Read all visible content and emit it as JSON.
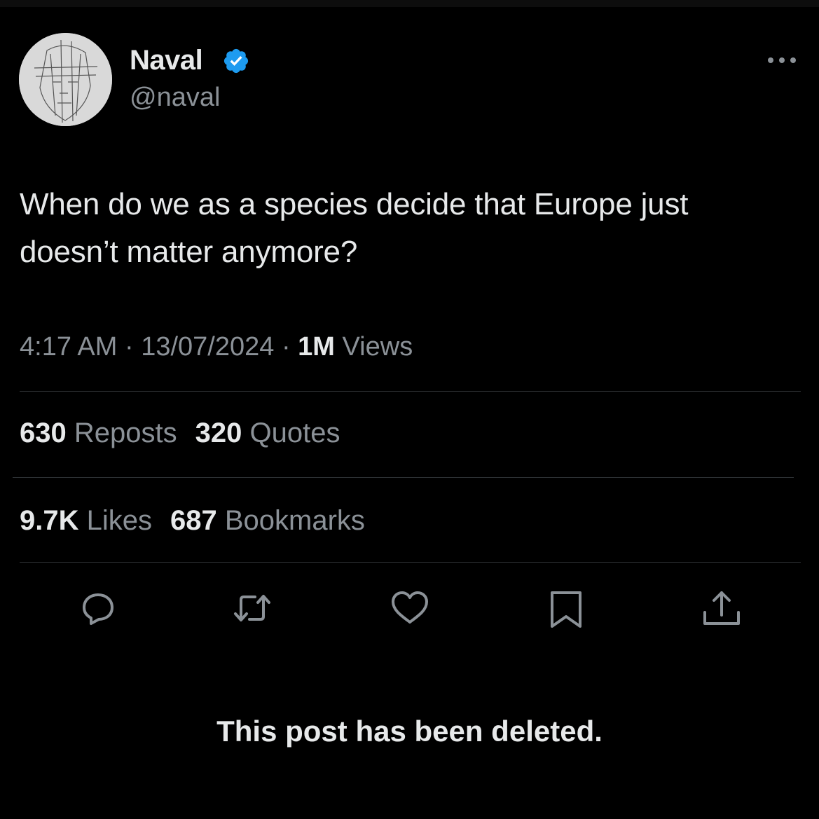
{
  "author": {
    "display_name": "Naval",
    "handle": "@naval",
    "verified": true,
    "verified_color": "#1d9bf0"
  },
  "post": {
    "text_line_1": "When do we as a species decide that Europe just",
    "text_line_2": "doesn’t matter anymore?"
  },
  "meta": {
    "time": "4:17 AM",
    "sep1": " · ",
    "date": "13/07/2024",
    "sep2": " · ",
    "views_count": "1M",
    "views_label": " Views"
  },
  "stats": {
    "reposts_count": "630",
    "reposts_label": " Reposts",
    "quotes_count": "320",
    "quotes_label": " Quotes",
    "likes_count": "9.7K",
    "likes_label": " Likes",
    "bookmarks_count": "687",
    "bookmarks_label": " Bookmarks"
  },
  "actions": [
    "reply-icon",
    "repost-icon",
    "like-icon",
    "bookmark-icon",
    "share-icon"
  ],
  "notice": "This post has been deleted.",
  "colors": {
    "background": "#000000",
    "primary_text": "#e7e9ea",
    "secondary_text": "#8b9197",
    "divider": "#2f3336"
  }
}
